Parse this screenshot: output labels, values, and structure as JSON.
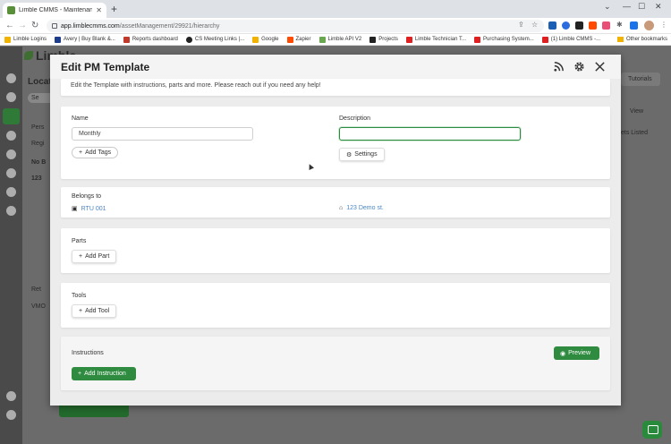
{
  "browser": {
    "tab_title": "Limble CMMS - Maintenance M...",
    "url_host": "app.limblecmms.com",
    "url_path": "/assetManagement/29921/hierarchy",
    "bookmarks": [
      {
        "label": "Limble Logins",
        "color": "#f2b300"
      },
      {
        "label": "Avery | Buy Blank &...",
        "color": "#1e3c8c"
      },
      {
        "label": "Reports dashboard",
        "color": "#c0392b"
      },
      {
        "label": "CS Meeting Links |...",
        "color": "#222222"
      },
      {
        "label": "Google",
        "color": "#f2b300"
      },
      {
        "label": "Zapier",
        "color": "#ff4a00"
      },
      {
        "label": "Limble API V2",
        "color": "#6aa84f"
      },
      {
        "label": "Projects",
        "color": "#222222"
      },
      {
        "label": "Limble Technician T...",
        "color": "#e02020"
      },
      {
        "label": "Purchasing System...",
        "color": "#e02020"
      },
      {
        "label": "(1) Limble CMMS -...",
        "color": "#e02020"
      }
    ],
    "other_bookmarks": "Other bookmarks"
  },
  "background": {
    "logo": "Limble",
    "heading": "Locat",
    "search_placeholder": "Se",
    "items": [
      "Pers",
      "Regi",
      "No B",
      "123",
      "Ret",
      "VMO"
    ],
    "right_items": [
      "Tutorials",
      "View",
      "ets Listed"
    ]
  },
  "modal": {
    "title": "Edit PM Template",
    "intro": "Edit the Template with instructions, parts and more. Please reach out if you need any help!",
    "name_label": "Name",
    "name_value": "Monthly",
    "description_label": "Description",
    "description_value": "",
    "add_tags_label": "Add Tags",
    "settings_label": "Settings",
    "belongs_to_label": "Belongs to",
    "asset_link": "RTU 001",
    "location_link": "123 Demo st.",
    "parts_label": "Parts",
    "add_part_label": "Add Part",
    "tools_label": "Tools",
    "add_tool_label": "Add Tool",
    "instructions_label": "Instructions",
    "preview_label": "Preview",
    "add_instruction_label": "Add Instruction"
  },
  "colors": {
    "brand_green": "#2e8b3f",
    "link_blue": "#4a86c5",
    "focus_green": "#2d8a3e"
  }
}
